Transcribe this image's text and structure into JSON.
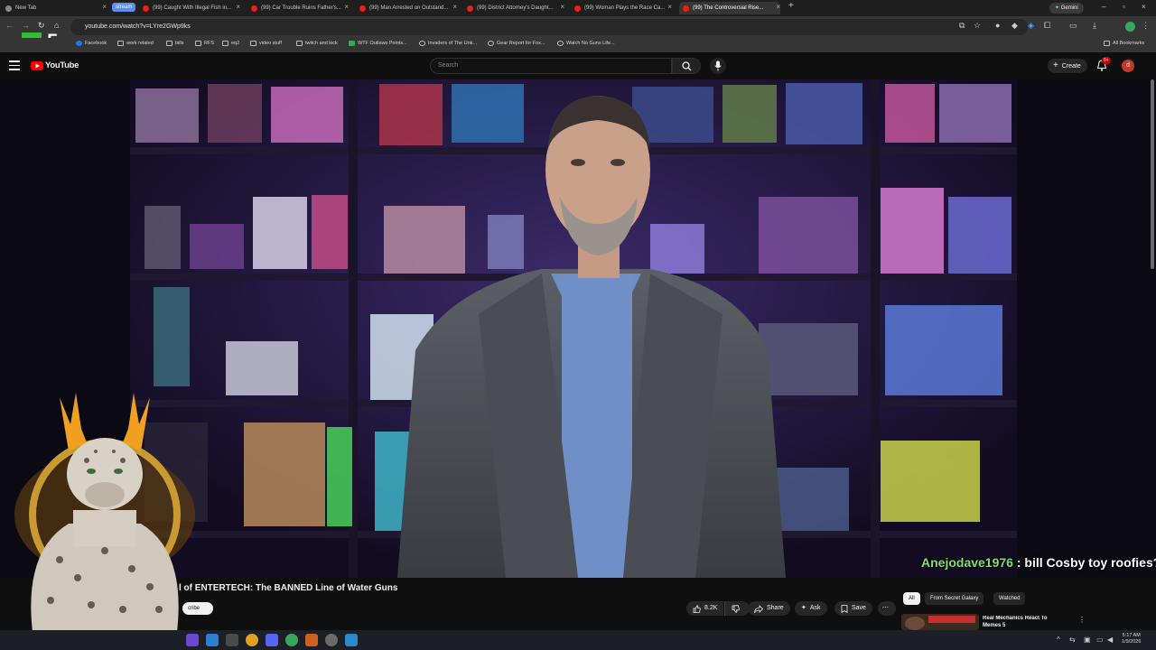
{
  "browser": {
    "tabs": [
      {
        "label": "New Tab",
        "icon": "globe-icon"
      },
      {
        "label": "(99) Caught With Illegal Fish in...",
        "icon": "youtube-icon"
      },
      {
        "label": "(99) Car Trouble Ruins Father's...",
        "icon": "youtube-icon"
      },
      {
        "label": "(99) Man Arrested on Outstand...",
        "icon": "youtube-icon"
      },
      {
        "label": "(99) District Attorney's Daught...",
        "icon": "youtube-icon"
      },
      {
        "label": "(99) Woman Plays the Race Ca...",
        "icon": "youtube-icon"
      },
      {
        "label": "(99) The Controversial Rise...",
        "icon": "youtube-icon"
      }
    ],
    "tab_group_label": "stream",
    "gemini_label": "Gemini",
    "url": "youtube.com/watch?v=LYre2GWp9ks",
    "bookmarks": [
      {
        "label": "Facebook",
        "icon": "facebook-icon"
      },
      {
        "label": "work related",
        "icon": "folder-icon"
      },
      {
        "label": "bills",
        "icon": "folder-icon"
      },
      {
        "label": "RFS",
        "icon": "folder-icon"
      },
      {
        "label": "eq2",
        "icon": "folder-icon"
      },
      {
        "label": "video stuff",
        "icon": "folder-icon"
      },
      {
        "label": "twitch and kick",
        "icon": "folder-icon"
      },
      {
        "label": "WTF Outlaws Points...",
        "icon": "site-icon"
      },
      {
        "label": "Invaders of The Unk...",
        "icon": "site-icon"
      },
      {
        "label": "Gear Report for Fox...",
        "icon": "site-icon"
      },
      {
        "label": "Watch No Guns Life...",
        "icon": "site-icon"
      }
    ],
    "all_bookmarks_label": "All Bookmarks",
    "corner_logo": "5"
  },
  "youtube": {
    "logo_text": "YouTube",
    "search_placeholder": "Search",
    "create_label": "Create",
    "notification_count": "9+",
    "avatar_letter": "d",
    "video_title": "l of ENTERTECH: The BANNED Line of Water Guns",
    "subscribe_label": "cribe",
    "actions": {
      "like_count": "8.2K",
      "share_label": "Share",
      "ask_label": "Ask",
      "save_label": "Save"
    },
    "chips": [
      "All",
      "From Secret Galaxy",
      "Watched"
    ],
    "recommended": [
      {
        "title": "Real Mechanics React To Memes 5"
      }
    ]
  },
  "overlay": {
    "chat_user": "Anejodave1976",
    "chat_message": " : bill Cosby toy roofies?"
  },
  "taskbar": {
    "time": "5:17 AM",
    "date": "1/9/2026"
  },
  "colors": {
    "youtube_red": "#ff0000",
    "chat_username": "#7ee070",
    "background": "#0f0f0f"
  }
}
